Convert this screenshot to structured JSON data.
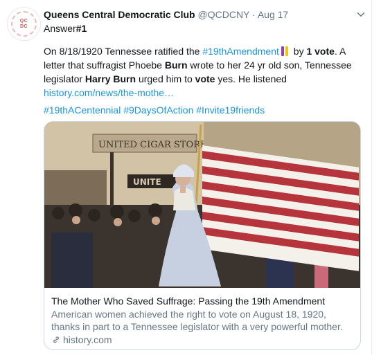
{
  "tweet": {
    "avatar_text_top": "QC",
    "avatar_text_bottom": "DC",
    "name": "Queens Central Democratic Club",
    "handle": "@QCDCNY",
    "separator": "·",
    "date": "Aug 17",
    "reply_prefix": "Answer",
    "reply_number": "#1",
    "text": {
      "part1": "On 8/18/1920 Tennessee ratified the ",
      "hashtag1": "#19thAmendment",
      "part2": " by ",
      "bold1": "1 vote",
      "part3": ". A letter that suffragist Phoebe ",
      "bold2": "Burn",
      "part4": " wrote to her 24 yr old son, Tennessee legislator ",
      "bold3": "Harry Burn",
      "part5": " urged him to ",
      "bold4": "vote",
      "part6": " yes. He listened",
      "link": "history.com/news/the-mothe…"
    },
    "hashtags": [
      "#19thACentennial",
      "#9DaysOfAction",
      "#Invite19friends"
    ]
  },
  "card": {
    "sign_text": "UNITED CIGAR STORES",
    "title": "The Mother Who Saved Suffrage: Passing the 19th Amendment",
    "description": "American women achieved the right to vote on August 18, 1920, thanks in part to a Tennessee legislator with a very powerful mother.",
    "domain": "history.com"
  },
  "colors": {
    "link": "#1b95e0",
    "secondary": "#657786",
    "primary_text": "#14171a",
    "suffrage_purple": "#8e44ad",
    "suffrage_gold": "#f1c40f"
  },
  "icons": {
    "chevron": "chevron-down-icon",
    "emoji": "suffrage-ribbon-emoji",
    "link": "link-icon"
  }
}
